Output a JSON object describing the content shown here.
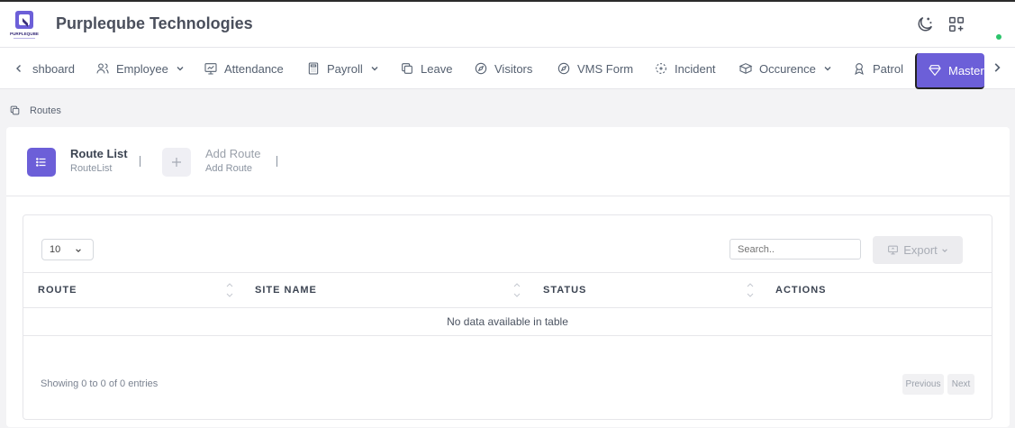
{
  "header": {
    "brand": "Purpleqube Technologies",
    "logo_text": "PURPLEQUBE",
    "icons": [
      "moon-icon",
      "grid-add-icon"
    ]
  },
  "nav": {
    "items": [
      {
        "label": "shboard",
        "icon": "chevron-left-icon"
      },
      {
        "label": "Employee",
        "icon": "users-icon",
        "dropdown": true
      },
      {
        "label": "Attendance",
        "icon": "monitor-chart-icon"
      },
      {
        "label": "Payroll",
        "icon": "calculator-icon",
        "dropdown": true
      },
      {
        "label": "Leave",
        "icon": "copy-icon"
      },
      {
        "label": "Visitors",
        "icon": "compass-icon"
      },
      {
        "label": "VMS Form",
        "icon": "compass-icon"
      },
      {
        "label": "Incident",
        "icon": "focus-icon"
      },
      {
        "label": "Occurence",
        "icon": "box-icon",
        "dropdown": true
      },
      {
        "label": "Patrol",
        "icon": "award-icon"
      }
    ],
    "active": {
      "label": "Master",
      "icon": "diamond-icon"
    }
  },
  "breadcrumb": {
    "label": "Routes"
  },
  "steps": {
    "list": {
      "title": "Route List",
      "subtitle": "RouteList"
    },
    "add": {
      "title": "Add Route",
      "subtitle": "Add Route"
    }
  },
  "table": {
    "page_length": "10",
    "search_placeholder": "Search..",
    "export_label": "Export",
    "columns": [
      "ROUTE",
      "SITE NAME",
      "STATUS",
      "ACTIONS"
    ],
    "empty_message": "No data available in table",
    "info": "Showing 0 to 0 of 0 entries",
    "prev_label": "Previous",
    "next_label": "Next"
  },
  "colors": {
    "accent": "#6c5fd8",
    "online": "#2bc46b"
  }
}
